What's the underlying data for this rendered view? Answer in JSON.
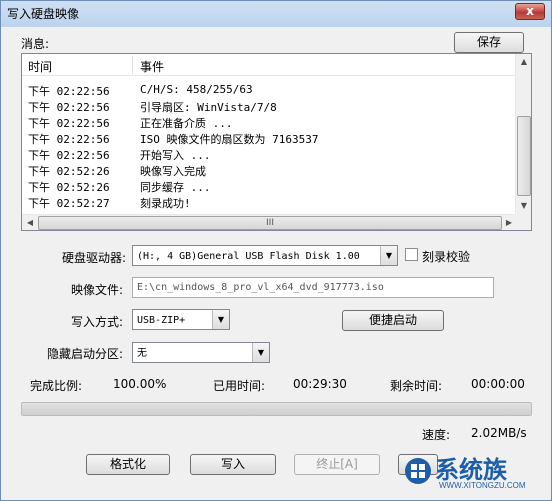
{
  "window": {
    "title": "写入硬盘映像",
    "close_label": "x"
  },
  "messages": {
    "label": "消息:",
    "save_label": "保存",
    "columns": [
      "时间",
      "事件"
    ],
    "rows": [
      {
        "time": "下午 02:22:56",
        "event": "C/H/S: 458/255/63"
      },
      {
        "time": "下午 02:22:56",
        "event": "引导扇区: WinVista/7/8"
      },
      {
        "time": "下午 02:22:56",
        "event": "正在准备介质 ..."
      },
      {
        "time": "下午 02:22:56",
        "event": "ISO 映像文件的扇区数为 7163537"
      },
      {
        "time": "下午 02:22:56",
        "event": "开始写入 ..."
      },
      {
        "time": "下午 02:52:26",
        "event": "映像写入完成"
      },
      {
        "time": "下午 02:52:26",
        "event": "同步缓存 ..."
      },
      {
        "time": "下午 02:52:27",
        "event": "刻录成功!"
      }
    ],
    "hscroll_grip": "III"
  },
  "drive": {
    "label": "硬盘驱动器:",
    "value": "(H:, 4 GB)General USB Flash Disk  1.00",
    "verify_label": "刻录校验",
    "verify_checked": false
  },
  "image_file": {
    "label": "映像文件:",
    "value": "E:\\cn_windows_8_pro_vl_x64_dvd_917773.iso"
  },
  "write_mode": {
    "label": "写入方式:",
    "value": "USB-ZIP+",
    "quick_boot_label": "便捷启动"
  },
  "hidden_partition": {
    "label": "隐藏启动分区:",
    "value": "无"
  },
  "status": {
    "ratio_label": "完成比例:",
    "ratio_value": "100.00%",
    "elapsed_label": "已用时间:",
    "elapsed_value": "00:29:30",
    "remaining_label": "剩余时间:",
    "remaining_value": "00:00:00",
    "progress": 1.0,
    "speed_label": "速度:",
    "speed_value": "2.02MB/s"
  },
  "buttons": {
    "format": "格式化",
    "write": "写入",
    "stop": "终止[A]"
  },
  "watermark": {
    "title": "系统族",
    "url": "WWW.XITONGZU.COM"
  },
  "colors": {
    "accent": "#1e5ea8",
    "close": "#c75050"
  }
}
